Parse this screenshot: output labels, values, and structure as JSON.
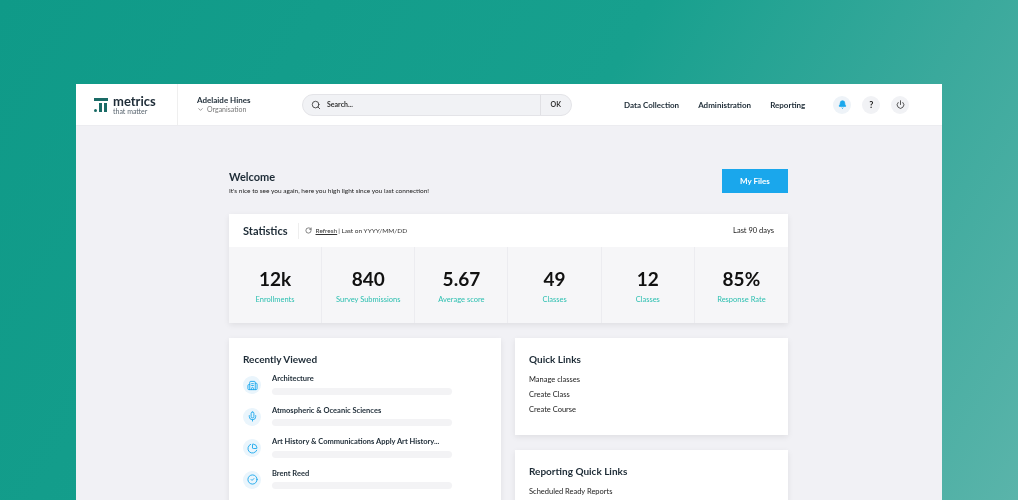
{
  "header": {
    "logo": {
      "word": "metrics",
      "tagline": "that matter"
    },
    "user": {
      "name": "Adelaide Hines",
      "org": "Organisation"
    },
    "search": {
      "placeholder": "Search...",
      "button": "OK"
    },
    "nav": [
      "Data Collection",
      "Administration",
      "Reporting"
    ],
    "help_glyph": "?"
  },
  "welcome": {
    "title": "Welcome",
    "subtitle": "It's nice to see you again, here you high light since you last connection!",
    "button": "My Files"
  },
  "statistics": {
    "title": "Statistics",
    "refresh": "Refresh",
    "last_on": "| Last on YYYY/MM/DD",
    "period": "Last 90 days",
    "items": [
      {
        "value": "12k",
        "label": "Enrollments"
      },
      {
        "value": "840",
        "label": "Survey Submissions"
      },
      {
        "value": "5.67",
        "label": "Average score"
      },
      {
        "value": "49",
        "label": "Classes"
      },
      {
        "value": "12",
        "label": "Classes"
      },
      {
        "value": "85%",
        "label": "Response Rate"
      }
    ]
  },
  "recently_viewed": {
    "title": "Recently Viewed",
    "items": [
      "Architecture",
      "Atmospheric & Oceanic Sciences",
      "Art History & Communications Apply Art History...",
      "Brent Reed"
    ]
  },
  "quick_links": {
    "title": "Quick Links",
    "items": [
      "Manage classes",
      "Create Class",
      "Create Course"
    ]
  },
  "reporting_quick_links": {
    "title": "Reporting Quick Links",
    "items": [
      "Scheduled Ready Reports"
    ]
  }
}
